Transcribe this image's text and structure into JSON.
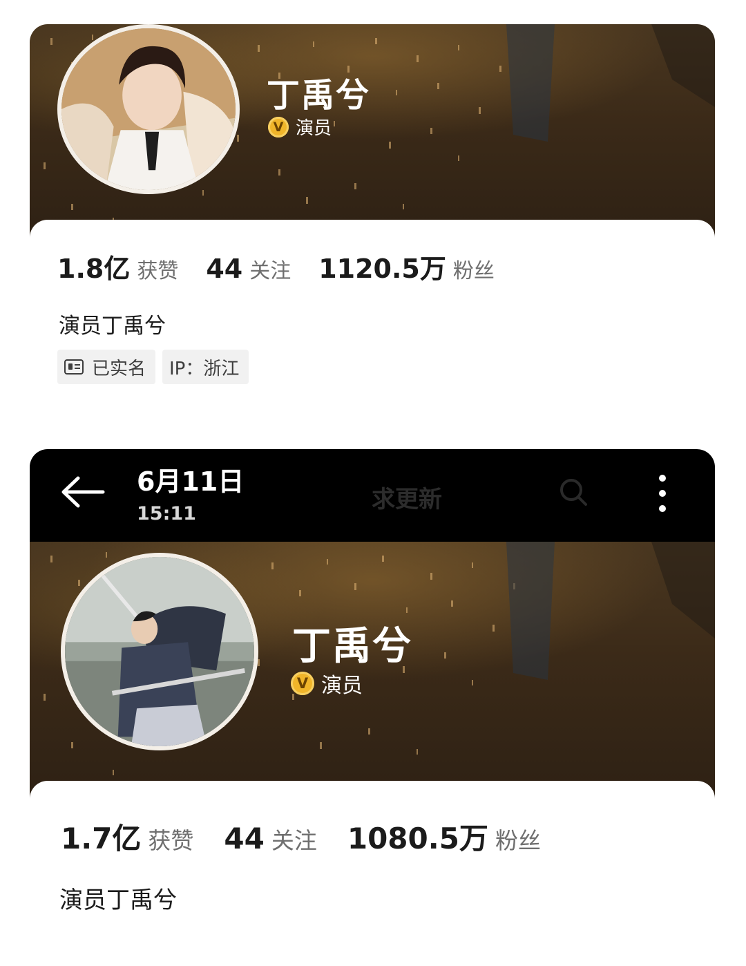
{
  "profiles": [
    {
      "name": "丁禹兮",
      "verified_badge": "V",
      "role": "演员",
      "stats": [
        {
          "value": "1.8亿",
          "label": "获赞"
        },
        {
          "value": "44",
          "label": "关注"
        },
        {
          "value": "1120.5万",
          "label": "粉丝"
        }
      ],
      "bio": "演员丁禹兮",
      "tags": {
        "verified_label": "已实名",
        "ip_label": "IP：浙江"
      }
    },
    {
      "name": "丁禹兮",
      "verified_badge": "V",
      "role": "演员",
      "stats": [
        {
          "value": "1.7亿",
          "label": "获赞"
        },
        {
          "value": "44",
          "label": "关注"
        },
        {
          "value": "1080.5万",
          "label": "粉丝"
        }
      ],
      "bio": "演员丁禹兮"
    }
  ],
  "topbar": {
    "date": "6月11日",
    "time": "15:11",
    "faded_label": "求更新"
  },
  "colors": {
    "cover_dark": "#3b2a18",
    "badge_gold": "#f0b52a",
    "stat_label_gray": "#6f6f6f",
    "tag_background": "#f1f1f1"
  },
  "icons": [
    "back-arrow-icon",
    "search-icon",
    "more-icon",
    "verified-v-icon",
    "id-card-icon"
  ]
}
